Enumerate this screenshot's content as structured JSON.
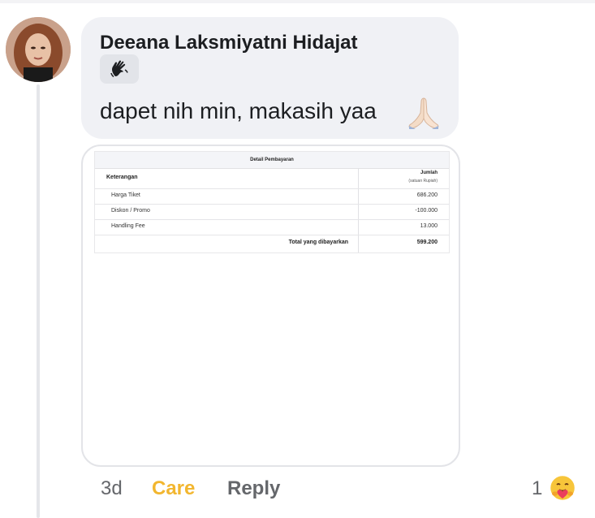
{
  "comment": {
    "author": "Deeana Laksmiyatni Hidajat",
    "badge_icon": "wave-hand-icon",
    "text": "dapet nih min, makasih yaa",
    "emoji_icon": "pray-hands-icon"
  },
  "attachment": {
    "title": "Detail Pembayaran",
    "header_left": "Keterangan",
    "header_right": "Jumlah",
    "header_right_sub": "(satuan Rupiah)",
    "rows": [
      {
        "label": "Harga Tiket",
        "amount": "686.200"
      },
      {
        "label": "Diskon / Promo",
        "amount": "-100.000"
      },
      {
        "label": "Handling Fee",
        "amount": "13.000"
      }
    ],
    "total_label": "Total yang dibayarkan",
    "total_amount": "599.200"
  },
  "actions": {
    "time": "3d",
    "reaction_label": "Care",
    "reply_label": "Reply",
    "reaction_count": "1",
    "reaction_icon": "care-reaction-icon"
  },
  "colors": {
    "bubble": "#f0f1f5",
    "care": "#f2b62f",
    "muted": "#65676b"
  }
}
